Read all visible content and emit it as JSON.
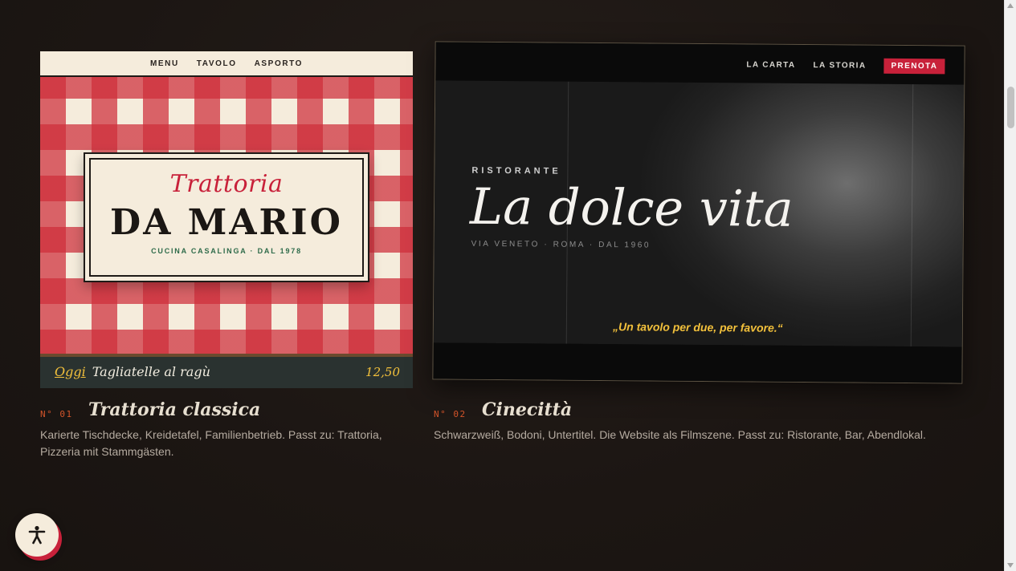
{
  "cards": [
    {
      "nav": [
        "MENU",
        "TAVOLO",
        "ASPORTO"
      ],
      "script_title": "Trattoria",
      "title": "DA MARIO",
      "subtitle": "CUCINA CASALINGA · DAL 1978",
      "board_label": "Oggi",
      "board_dish": "Tagliatelle al ragù",
      "board_price": "12,50",
      "number": "N° 01",
      "caption_title": "Trattoria classica",
      "caption_desc": "Karierte Tischdecke, Kreidetafel, Familienbetrieb. Passt zu: Trattoria, Pizzeria mit Stammgästen."
    },
    {
      "nav": [
        "LA CARTA",
        "LA STORIA"
      ],
      "cta": "PRENOTA",
      "eyebrow": "RISTORANTE",
      "title": "La dolce vita",
      "subline": "VIA VENETO · ROMA · DAL 1960",
      "film_subtitle": "„Un tavolo per due, per favore.“",
      "number": "N° 02",
      "caption_title": "Cinecittà",
      "caption_desc": "Schwarzweiß, Bodoni, Untertitel. Die Website als Filmszene. Passt zu: Ristorante, Bar, Abendlokal."
    }
  ],
  "colors": {
    "background": "#1c1613",
    "gingham_red": "#ce2d3a",
    "cream": "#f5ecdc",
    "accent_gold": "#f2c03b",
    "accent_orange": "#d2542a"
  },
  "icons": {
    "accessibility": "accessibility-person-icon"
  }
}
